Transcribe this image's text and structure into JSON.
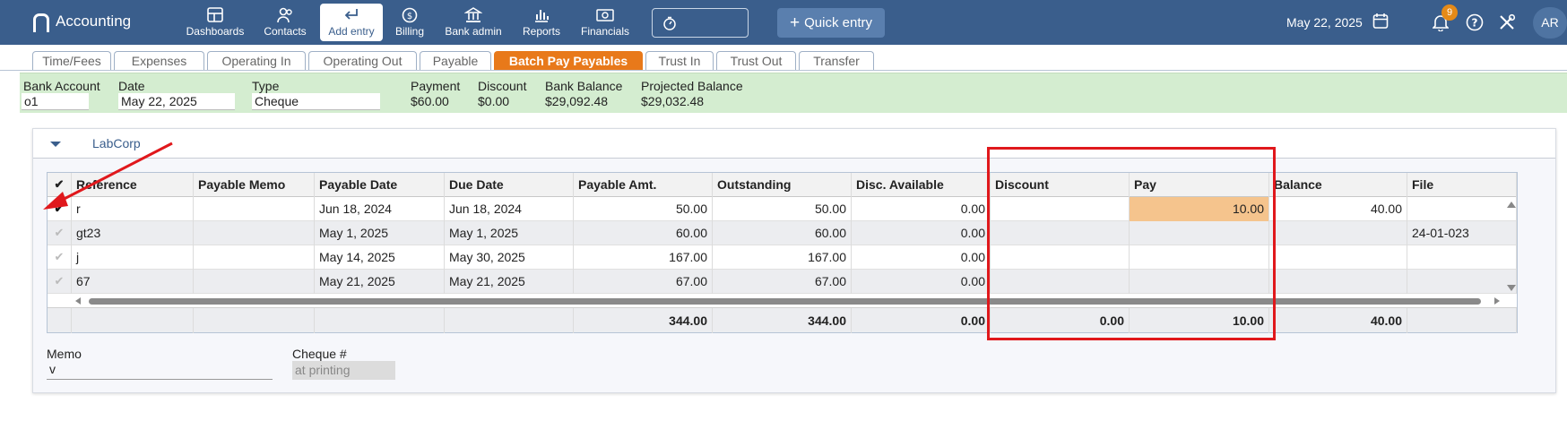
{
  "app": {
    "title": "Accounting",
    "date": "May 22, 2025",
    "notifications": "9",
    "avatar": "AR"
  },
  "nav": {
    "dashboards": "Dashboards",
    "contacts": "Contacts",
    "add_entry": "Add entry",
    "billing": "Billing",
    "bank_admin": "Bank admin",
    "reports": "Reports",
    "financials": "Financials",
    "quick_entry": "Quick entry"
  },
  "tabs": [
    "Time/Fees",
    "Expenses",
    "Operating In",
    "Operating Out",
    "Payable",
    "Batch Pay Payables",
    "Trust In",
    "Trust Out",
    "Transfer"
  ],
  "form": {
    "bank_account_label": "Bank Account",
    "bank_account": "o1",
    "date_label": "Date",
    "date": "May 22, 2025",
    "type_label": "Type",
    "type": "Cheque",
    "payment_label": "Payment",
    "payment": "$60.00",
    "discount_label": "Discount",
    "discount": "$0.00",
    "bank_balance_label": "Bank Balance",
    "bank_balance": "$29,092.48",
    "projected_label": "Projected Balance",
    "projected": "$29,032.48"
  },
  "vendor": "LabCorp",
  "table": {
    "headers": [
      "Reference",
      "Payable Memo",
      "Payable Date",
      "Due Date",
      "Payable Amt.",
      "Outstanding",
      "Disc. Available",
      "Discount",
      "Pay",
      "Balance",
      "File"
    ],
    "rows": [
      {
        "check": "✔",
        "checked": true,
        "ref": "r",
        "memo": "",
        "pdate": "Jun 18, 2024",
        "due": "Jun 18, 2024",
        "amt": "50.00",
        "out": "50.00",
        "disc_avail": "0.00",
        "disc": "",
        "pay": "10.00",
        "bal": "40.00",
        "file": ""
      },
      {
        "check": "✔",
        "checked": false,
        "ref": "gt23",
        "memo": "",
        "pdate": "May 1, 2025",
        "due": "May 1, 2025",
        "amt": "60.00",
        "out": "60.00",
        "disc_avail": "0.00",
        "disc": "",
        "pay": "",
        "bal": "",
        "file": "24-01-023"
      },
      {
        "check": "✔",
        "checked": false,
        "ref": "j",
        "memo": "",
        "pdate": "May 14, 2025",
        "due": "May 30, 2025",
        "amt": "167.00",
        "out": "167.00",
        "disc_avail": "0.00",
        "disc": "",
        "pay": "",
        "bal": "",
        "file": ""
      },
      {
        "check": "✔",
        "checked": false,
        "ref": "67",
        "memo": "",
        "pdate": "May 21, 2025",
        "due": "May 21, 2025",
        "amt": "67.00",
        "out": "67.00",
        "disc_avail": "0.00",
        "disc": "",
        "pay": "",
        "bal": "",
        "file": ""
      }
    ],
    "totals": {
      "amt": "344.00",
      "out": "344.00",
      "disc_avail": "0.00",
      "disc": "0.00",
      "pay": "10.00",
      "bal": "40.00"
    }
  },
  "footer": {
    "memo_label": "Memo",
    "memo": "v",
    "cheque_label": "Cheque #",
    "cheque": "at printing"
  },
  "colors": {
    "header": "#3a5e8c",
    "active_tab": "#e8791a",
    "pay_highlight": "#f5c48d",
    "annotation": "#e0181c",
    "summary_bg": "#d4edd0"
  }
}
